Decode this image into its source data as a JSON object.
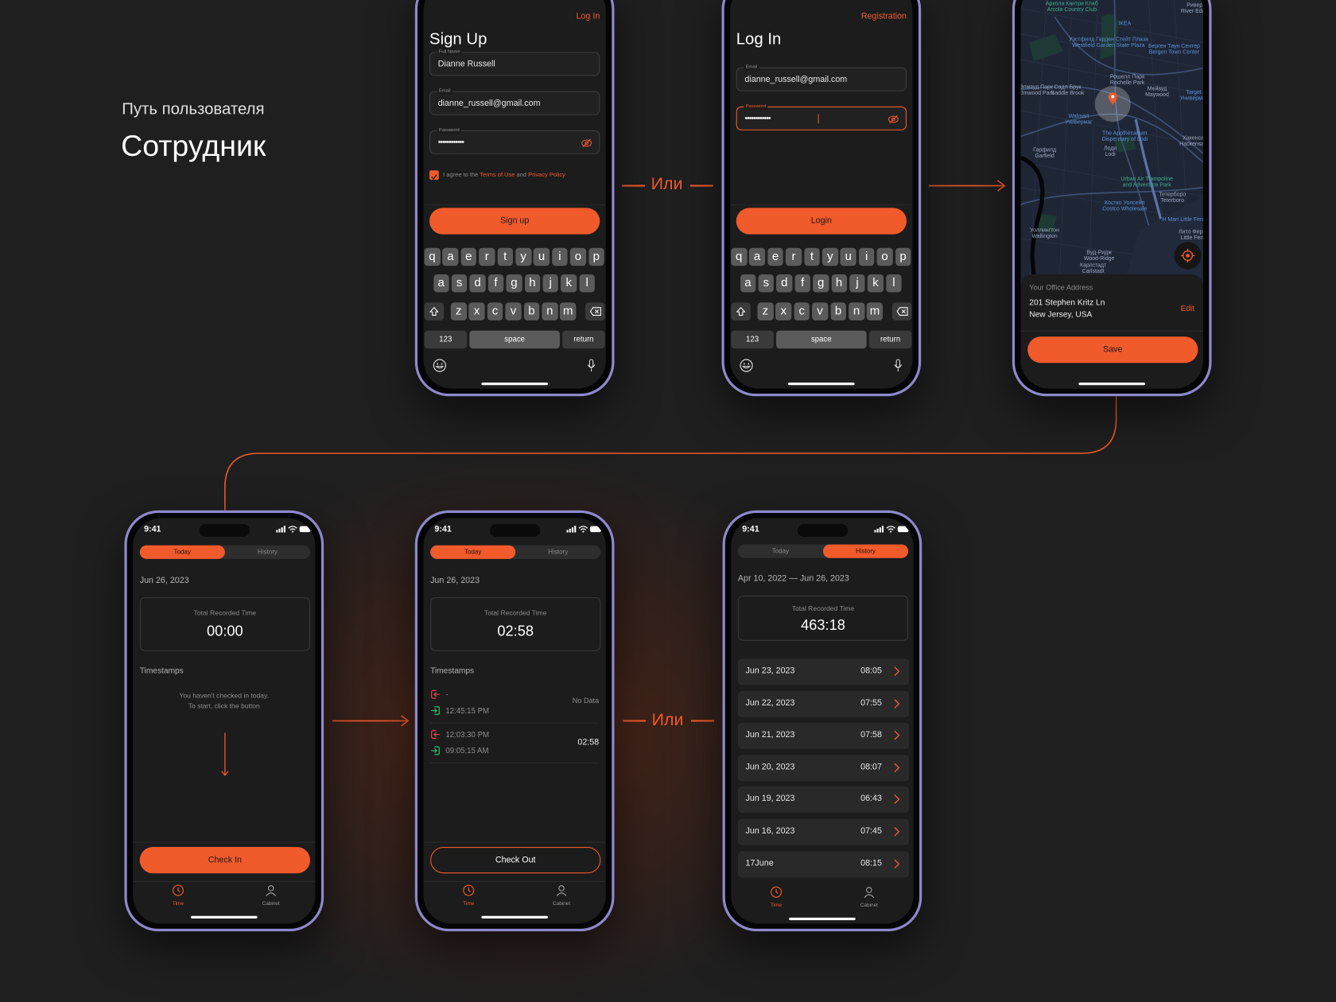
{
  "intro": {
    "subtitle": "Путь пользователя",
    "title": "Сотрудник"
  },
  "connectors": {
    "or_1": "Или",
    "or_2": "Или"
  },
  "colors": {
    "accent": "#f15a2b",
    "frame": "#8e88cc",
    "screen": "#1c1c1c",
    "check_in_icon": "#2fbf71",
    "check_out_icon": "#e5484d"
  },
  "signup": {
    "login_link": "Log In",
    "title": "Sign Up",
    "full_name": {
      "label": "Full Name",
      "value": "Dianne Russell"
    },
    "email": {
      "label": "Email",
      "value": "dianne_russell@gmail.com"
    },
    "password": {
      "label": "Password",
      "value": "••••••••••••",
      "icon": "eye-off-icon"
    },
    "agree": {
      "checked": true,
      "prefix": "I agree to the ",
      "terms": "Terms of Use",
      "and": " and ",
      "privacy": "Privacy Policy"
    },
    "button": "Sign up"
  },
  "login": {
    "registration_link": "Registration",
    "title": "Log In",
    "email": {
      "label": "Email",
      "value": "dianne_russell@gmail.com"
    },
    "password": {
      "label": "Password",
      "value": "••••••••••••",
      "icon": "eye-off-icon"
    },
    "button": "Login"
  },
  "keyboard": {
    "rows": [
      [
        "q",
        "a",
        "e",
        "r",
        "t",
        "y",
        "u",
        "i",
        "o",
        "p"
      ],
      [
        "a",
        "s",
        "d",
        "f",
        "g",
        "h",
        "j",
        "k",
        "l"
      ],
      [
        "z",
        "x",
        "c",
        "v",
        "b",
        "n",
        "m"
      ]
    ],
    "numbers": "123",
    "space": "space",
    "return": "return"
  },
  "office": {
    "map_labels": [
      {
        "ru": "Арколa Кантри Клаб",
        "en": "Arcola Country Club",
        "kind": "park"
      },
      {
        "ru": "Ривер",
        "en": "River Edge",
        "kind": "place"
      },
      {
        "ru": "IKEA",
        "en": "",
        "kind": "poi"
      },
      {
        "ru": "Уэстфилд Гарден Стейт Плаза",
        "en": "Westfield Garden State Plaza",
        "kind": "poi"
      },
      {
        "ru": "Берген Таун Сентер",
        "en": "Bergen Town Center",
        "kind": "poi"
      },
      {
        "ru": "Рошелл Парк",
        "en": "Rochelle Park",
        "kind": "place"
      },
      {
        "ru": "Элмвуд Парк",
        "en": "Elmwood Park",
        "kind": "place"
      },
      {
        "ru": "Садл Брук",
        "en": "Saddle Brook",
        "kind": "place"
      },
      {
        "ru": "Мейвуд",
        "en": "Maywood",
        "kind": "place"
      },
      {
        "ru": "Target",
        "en": "Универмаг",
        "kind": "poi"
      },
      {
        "ru": "Walmart",
        "en": "Универмаг",
        "kind": "poi"
      },
      {
        "ru": "The Apothecarium",
        "en": "Dispensary of Lodi",
        "kind": "poi"
      },
      {
        "ru": "Хакенсак",
        "en": "Hackensack",
        "kind": "place"
      },
      {
        "ru": "Гарфилд",
        "en": "Garfield",
        "kind": "place"
      },
      {
        "ru": "Лоди",
        "en": "Lodi",
        "kind": "place"
      },
      {
        "ru": "Urban Air Trampoline",
        "en": "and Adventure Park",
        "kind": "park"
      },
      {
        "ru": "Тетерборо",
        "en": "Teterboro",
        "kind": "place"
      },
      {
        "ru": "Костко Уолсейл",
        "en": "Costco Wholesale",
        "kind": "poi"
      },
      {
        "ru": "H Mart Little Ferry",
        "en": "",
        "kind": "poi"
      },
      {
        "ru": "Уоллингтон",
        "en": "Wallington",
        "kind": "place"
      },
      {
        "ru": "Литл Ферри",
        "en": "Little Ferry",
        "kind": "place"
      },
      {
        "ru": "Вуд-Ридж",
        "en": "Wood-Ridge",
        "kind": "place"
      },
      {
        "ru": "Карлстадт",
        "en": "Carlstadt",
        "kind": "place"
      }
    ],
    "address_label": "Your Office Address",
    "address_line1": "201 Stephen Kritz Ln",
    "address_line2": "New Jersey, USA",
    "edit": "Edit",
    "button": "Save"
  },
  "status_bar": {
    "time": "9:41"
  },
  "segments": {
    "today": "Today",
    "history": "History"
  },
  "tabbar": {
    "time": "Time",
    "cabinet": "Cabinet"
  },
  "today_empty": {
    "date": "Jun 26, 2023",
    "total_label": "Total Recorded Time",
    "total": "00:00",
    "timestamps_title": "Timestamps",
    "message_line1": "You haven't checked in today.",
    "message_line2": "To start, click the button",
    "button": "Check In"
  },
  "today_active": {
    "date": "Jun 26, 2023",
    "total_label": "Total Recorded Time",
    "total": "02:58",
    "timestamps_title": "Timestamps",
    "entries": [
      {
        "out": "-",
        "in": "12:45:15 PM",
        "duration": "No Data"
      },
      {
        "out": "12:03:30 PM",
        "in": "09:05:15 AM",
        "duration": "02:58"
      }
    ],
    "button": "Check Out"
  },
  "history": {
    "range": "Apr 10, 2022 — Jun 26, 2023",
    "total_label": "Total Recorded Time",
    "total": "463:18",
    "items": [
      {
        "date": "Jun 23, 2023",
        "time": "08:05"
      },
      {
        "date": "Jun 22, 2023",
        "time": "07:55"
      },
      {
        "date": "Jun 21, 2023",
        "time": "07:58"
      },
      {
        "date": "Jun 20, 2023",
        "time": "08:07"
      },
      {
        "date": "Jun 19, 2023",
        "time": "06:43"
      },
      {
        "date": "Jun 16, 2023",
        "time": "07:45"
      },
      {
        "date": "17June",
        "time": "08:15"
      }
    ]
  }
}
